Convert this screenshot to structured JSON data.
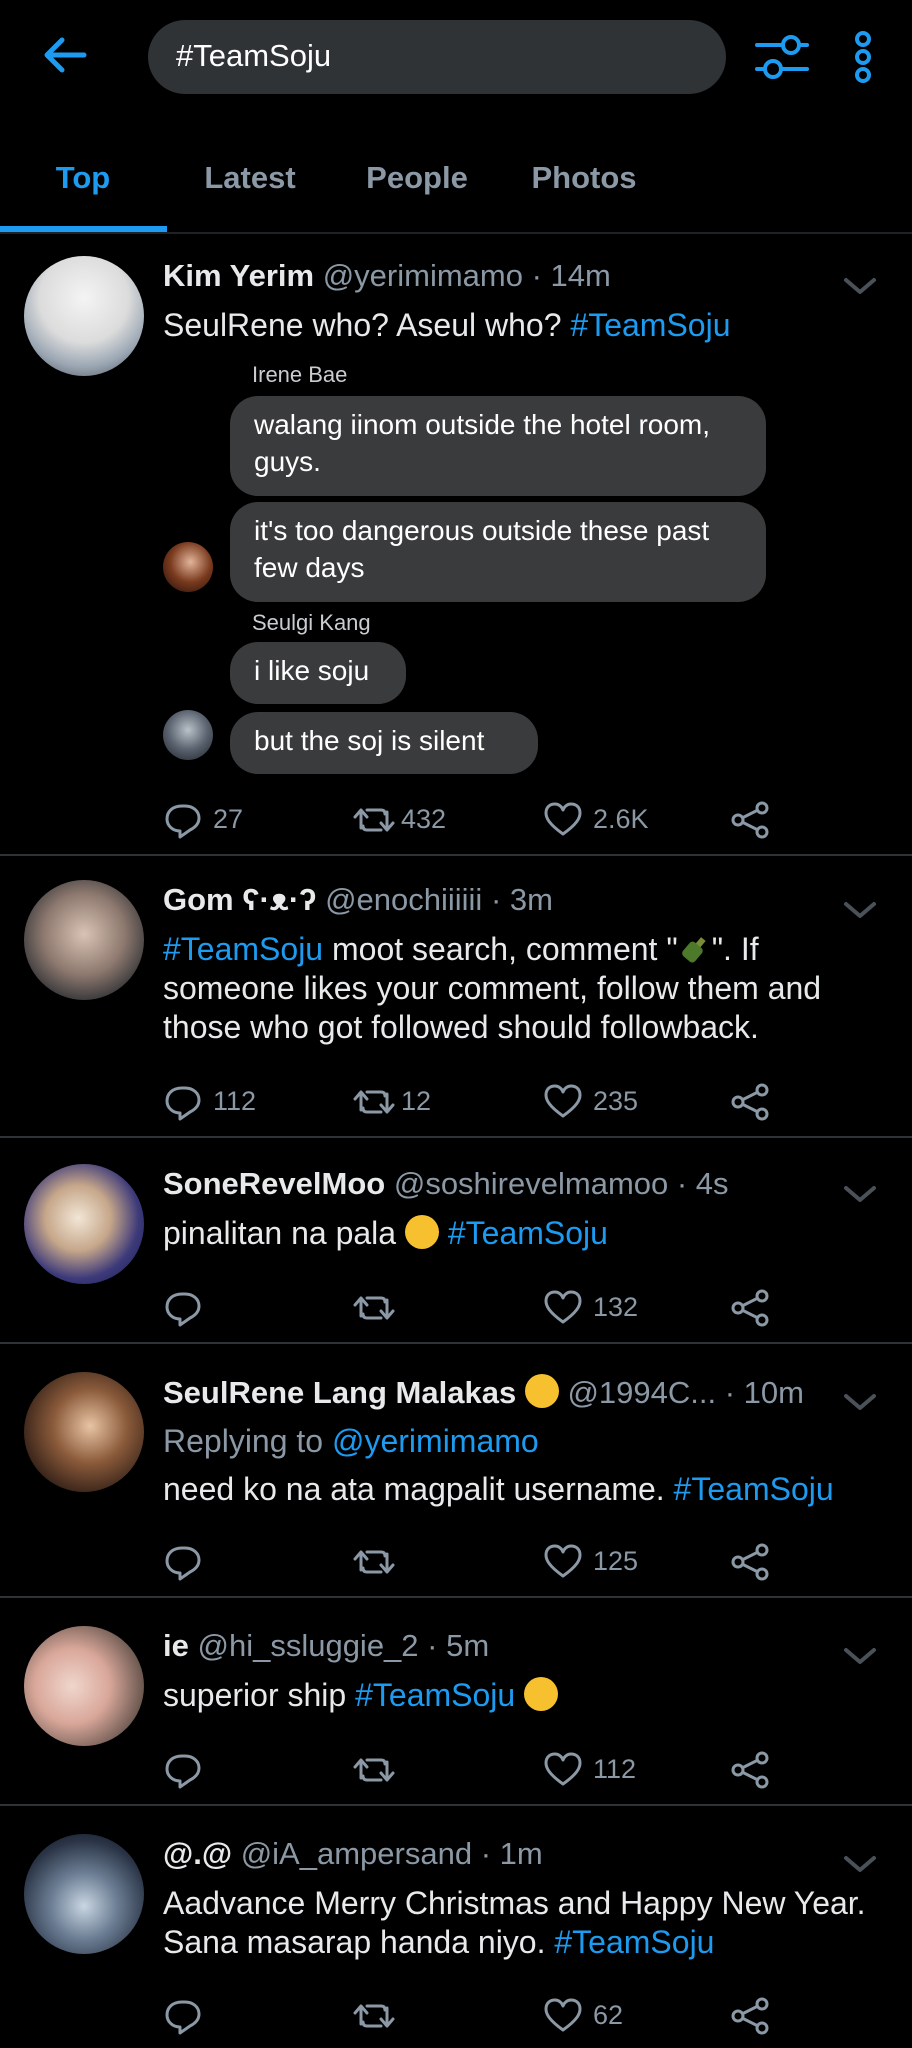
{
  "search": {
    "query": "#TeamSoju"
  },
  "tabs": [
    {
      "label": "Top"
    },
    {
      "label": "Latest"
    },
    {
      "label": "People"
    },
    {
      "label": "Photos"
    }
  ],
  "colors": {
    "accent": "#1d9bf0",
    "background": "#000000",
    "muted": "#8b98a5"
  },
  "tweets": [
    {
      "name": "Kim Yerim",
      "handle": "@yerimimamo",
      "time": "· 14m",
      "text": "SeulRene who? Aseul who?",
      "hashtag": "#TeamSoju",
      "chat": {
        "sender1": "Irene Bae",
        "msg1": "walang iinom outside the hotel room, guys.",
        "msg2": "it's too dangerous outside these past few days",
        "sender2": "Seulgi Kang",
        "msg3": "i like soju",
        "msg4": "but the soj is silent"
      },
      "replies": "27",
      "retweets": "432",
      "likes": "2.6K"
    },
    {
      "name": "Gom ʕ·ᴥ·ʔ",
      "handle": "@enochiiiiii",
      "time": "· 3m",
      "hashtag": "#TeamSoju",
      "text_a": " moot search, comment \"",
      "text_b": "\". If someone likes your comment, follow them and those who got followed should followback.",
      "replies": "112",
      "retweets": "12",
      "likes": "235"
    },
    {
      "name": "SoneRevelMoo",
      "handle": "@soshirevelmamoo",
      "time": "· 4s",
      "text": "pinalitan na pala",
      "hashtag": "#TeamSoju",
      "likes": "132"
    },
    {
      "name": "SeulRene Lang Malakas",
      "handle": "@1994C...",
      "time": "· 10m",
      "reply_prefix": "Replying to",
      "reply_to": "@yerimimamo",
      "text": "need ko na ata magpalit username.",
      "hashtag": "#TeamSoju",
      "likes": "125"
    },
    {
      "name": "ie",
      "handle": "@hi_ssluggie_2",
      "time": "· 5m",
      "text": "superior ship",
      "hashtag": "#TeamSoju",
      "likes": "112"
    },
    {
      "name": "@.@",
      "handle": "@iA_ampersand",
      "time": "· 1m",
      "text": "Aadvance Merry Christmas and Happy New Year. Sana masarap handa niyo.",
      "hashtag": "#TeamSoju",
      "likes": "62"
    }
  ]
}
